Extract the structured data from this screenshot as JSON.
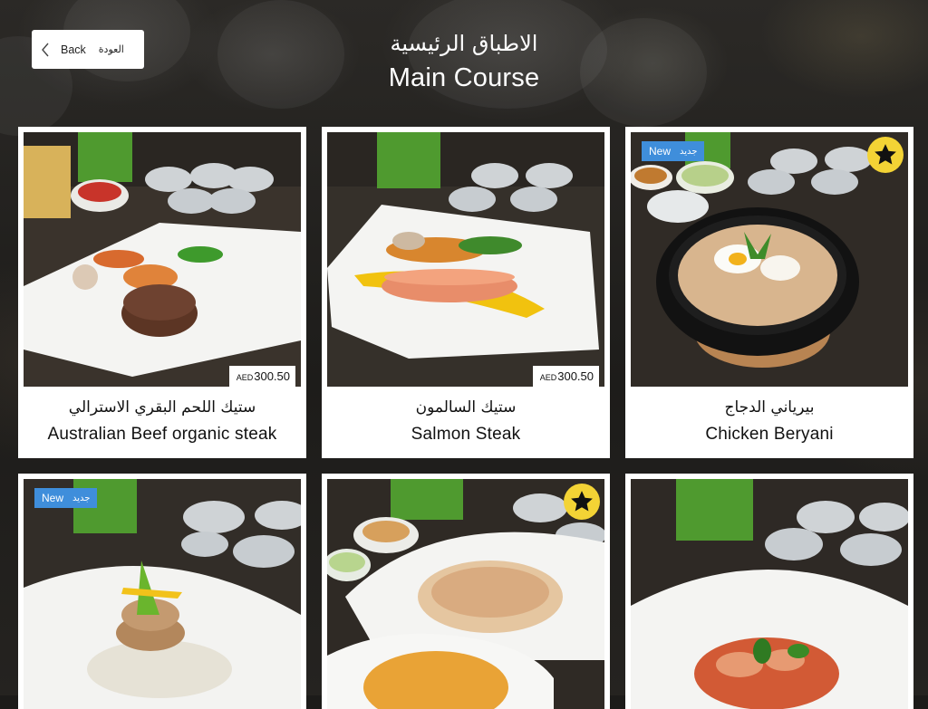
{
  "header": {
    "back_label_en": "Back",
    "back_label_ar": "العودة",
    "title_ar": "الاطباق الرئيسية",
    "title_en": "Main Course"
  },
  "items": [
    {
      "name_ar": "ستيك اللحم البقري الاسترالي",
      "name_en": "Australian Beef organic steak",
      "currency": "AED",
      "price": "300.50",
      "is_new": false,
      "is_featured": false
    },
    {
      "name_ar": "ستيك السالمون",
      "name_en": "Salmon Steak",
      "currency": "AED",
      "price": "300.50",
      "is_new": false,
      "is_featured": false
    },
    {
      "name_ar": "بيرياني الدجاج",
      "name_en": "Chicken Beryani",
      "is_new": true,
      "is_featured": true
    },
    {
      "is_new": true,
      "is_featured": false
    },
    {
      "is_new": false,
      "is_featured": true
    },
    {
      "is_new": false,
      "is_featured": false
    }
  ],
  "badge": {
    "new_en": "New",
    "new_ar": "جديد"
  },
  "colors": {
    "new_badge": "#3f8edb",
    "star_badge": "#f3d335",
    "card": "#ffffff"
  },
  "icons": {
    "back": "chevron-left-icon",
    "featured": "star-icon"
  }
}
